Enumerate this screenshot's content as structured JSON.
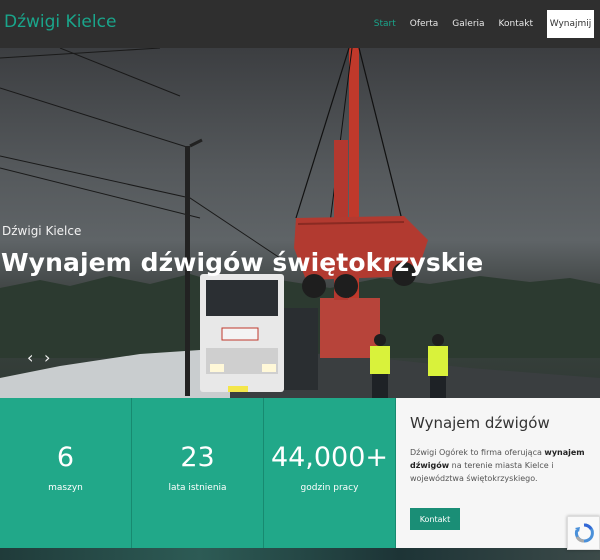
{
  "nav": {
    "brand": "Dźwigi Kielce",
    "links": [
      "Start",
      "Oferta",
      "Galeria",
      "Kontakt"
    ],
    "cta": "Wynajmij"
  },
  "hero": {
    "kicker": "Dźwigi Kielce",
    "title": "Wynajem dźwigów świętokrzyskie",
    "prev_icon": "chevron-left-icon",
    "next_icon": "chevron-right-icon"
  },
  "stats": [
    {
      "value": "6",
      "label": "maszyn"
    },
    {
      "value": "23",
      "label": "lata istnienia"
    },
    {
      "value": "44,000+",
      "label": "godzin pracy"
    }
  ],
  "info": {
    "title": "Wynajem dźwigów",
    "text_before": "Dźwigi Ogórek to firma oferująca ",
    "text_bold": "wynajem dźwigów",
    "text_after": " na terenie miasta Kielce i województwa świętokrzyskiego.",
    "button": "Kontakt"
  },
  "colors": {
    "accent": "#1aa58b",
    "nav_bg": "#2f2f2f",
    "stat_bg": "#21a889",
    "button_bg": "#1a8e76"
  }
}
